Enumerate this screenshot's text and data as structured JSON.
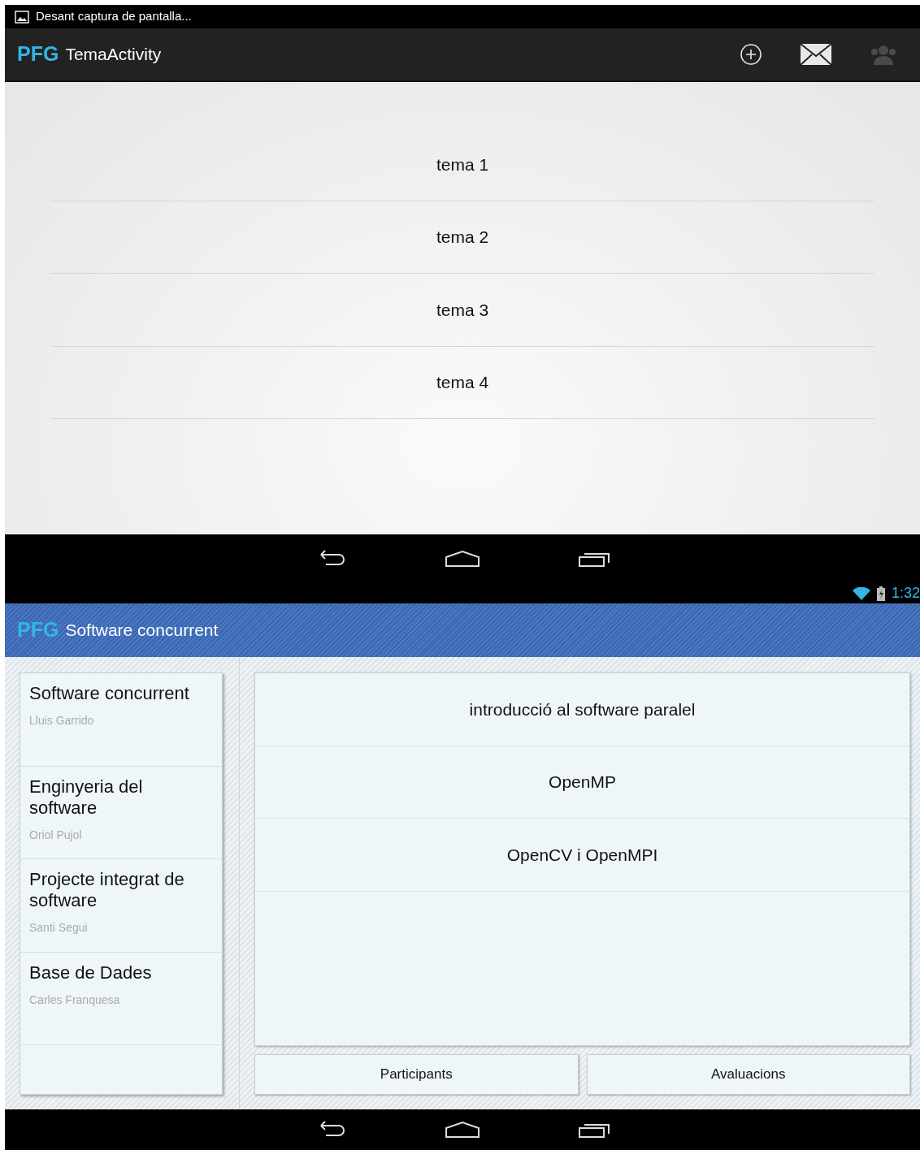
{
  "first_screen": {
    "status_bar": {
      "notification": "Desant captura de pantalla..."
    },
    "action_bar": {
      "logo": "PFG",
      "title": "TemaActivity",
      "actions": [
        {
          "kind": "add",
          "disabled": false
        },
        {
          "kind": "mail",
          "disabled": false
        },
        {
          "kind": "people",
          "disabled": true
        }
      ]
    },
    "topics": [
      "tema 1",
      "tema 2",
      "tema 3",
      "tema 4"
    ]
  },
  "second_screen": {
    "status_bar": {
      "time": "1:32"
    },
    "action_bar": {
      "logo": "PFG",
      "title": "Software concurrent"
    },
    "subjects": [
      {
        "title": "Software concurrent",
        "teacher": "Lluis Garrido"
      },
      {
        "title": "Enginyeria del software",
        "teacher": "Oriol Pujol"
      },
      {
        "title": "Projecte integrat de software",
        "teacher": "Santi Segui"
      },
      {
        "title": "Base de Dades",
        "teacher": "Carles Franquesa"
      }
    ],
    "topics": [
      "introducció al software paralel",
      "OpenMP",
      "OpenCV i OpenMPI"
    ],
    "buttons": [
      "Participants",
      "Avaluacions"
    ]
  }
}
